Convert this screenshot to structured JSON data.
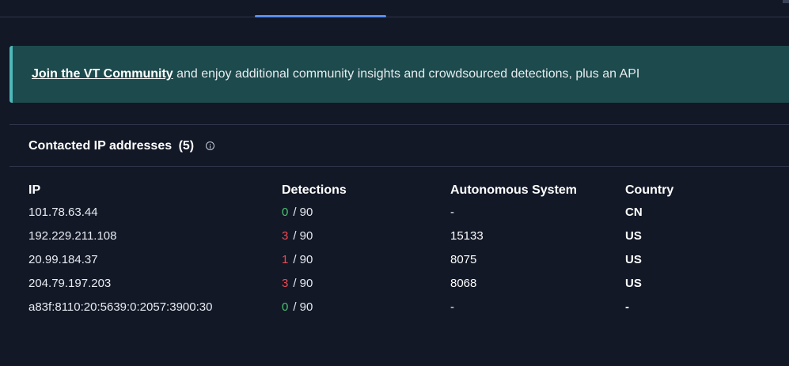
{
  "banner": {
    "link_label": "Join the VT Community",
    "text": " and enjoy additional community insights and crowdsourced detections, plus an API"
  },
  "section": {
    "title": "Contacted IP addresses",
    "count": "(5)"
  },
  "table": {
    "headers": {
      "ip": "IP",
      "detections": "Detections",
      "autonomous_system": "Autonomous System",
      "country": "Country"
    },
    "rows": [
      {
        "ip": "101.78.63.44",
        "detections": "0",
        "total": "/ 90",
        "as": "-",
        "country": "CN"
      },
      {
        "ip": "192.229.211.108",
        "detections": "3",
        "total": "/ 90",
        "as": "15133",
        "country": "US"
      },
      {
        "ip": "20.99.184.37",
        "detections": "1",
        "total": "/ 90",
        "as": "8075",
        "country": "US"
      },
      {
        "ip": "204.79.197.203",
        "detections": "3",
        "total": "/ 90",
        "as": "8068",
        "country": "US"
      },
      {
        "ip": "a83f:8110:20:5639:0:2057:3900:30",
        "detections": "0",
        "total": "/ 90",
        "as": "-",
        "country": "-"
      }
    ]
  },
  "colors": {
    "background": "#121826",
    "banner_bg": "#1d4a4c",
    "banner_accent": "#4fb8ba",
    "tab_active": "#5b8dee",
    "detection_clean": "#49c36f",
    "detection_flagged": "#ef4a52"
  },
  "icons": {
    "info": "info-icon"
  }
}
